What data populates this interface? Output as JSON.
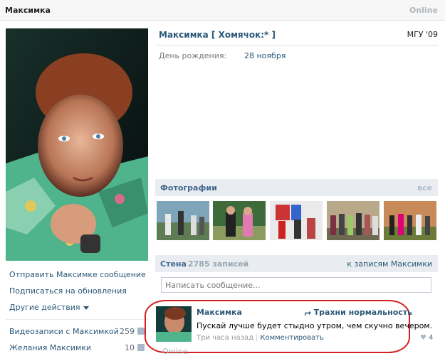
{
  "header": {
    "name": "Максимка",
    "status": "Online"
  },
  "profile": {
    "name": "Максимка [ Хомячок:* ]",
    "university": "МГУ '09",
    "birthday_label": "День рождения:",
    "birthday_value": "28 ноября"
  },
  "actions": {
    "send_message": "Отправить Максимке сообщение",
    "subscribe": "Подписаться на обновления",
    "more": "Другие действия"
  },
  "side_lists": [
    {
      "label": "Видеозаписи с Максимкой",
      "count": "259"
    },
    {
      "label": "Желания Максимки",
      "count": "10"
    }
  ],
  "photos": {
    "title": "Фотографии",
    "all_link": "все"
  },
  "wall": {
    "title": "Стена",
    "count": "2785 записей",
    "to_posts": "к записям Максимки",
    "input_placeholder": "Написать сообщение..."
  },
  "post": {
    "author": "Максимка",
    "share_label": "Трахни нормальность",
    "text": "Пускай лучше будет стыдно утром, чем скучно вечером.",
    "time": "Три часа назад",
    "comment": "Комментировать",
    "likes": "4"
  },
  "footer_status": "Online",
  "colors": {
    "link": "#2b587a",
    "section_bg": "#e9edf1",
    "highlight": "#d42020"
  }
}
